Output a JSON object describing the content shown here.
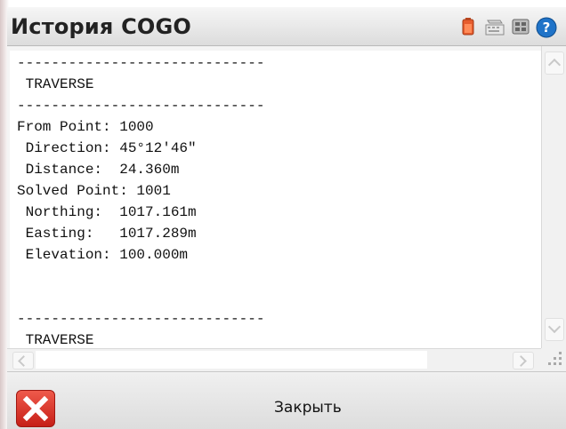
{
  "window": {
    "title": "История COGO"
  },
  "status_icons": [
    {
      "name": "battery-icon",
      "color": "#e65c2d"
    },
    {
      "name": "keyboard-icon",
      "color": "#8a8a8a"
    },
    {
      "name": "grid-icon",
      "color": "#666666"
    },
    {
      "name": "help-icon",
      "color": "#1f73c8"
    }
  ],
  "history": {
    "text": "-----------------------------\n TRAVERSE\n-----------------------------\nFrom Point: 1000\n Direction: 45°12'46\"\n Distance:  24.360m\nSolved Point: 1001\n Northing:  1017.161m\n Easting:   1017.289m\n Elevation: 100.000m\n\n\n-----------------------------\n TRAVERSE"
  },
  "footer": {
    "close_label": "Закрыть"
  },
  "colors": {
    "close_button": "#d9342b"
  }
}
